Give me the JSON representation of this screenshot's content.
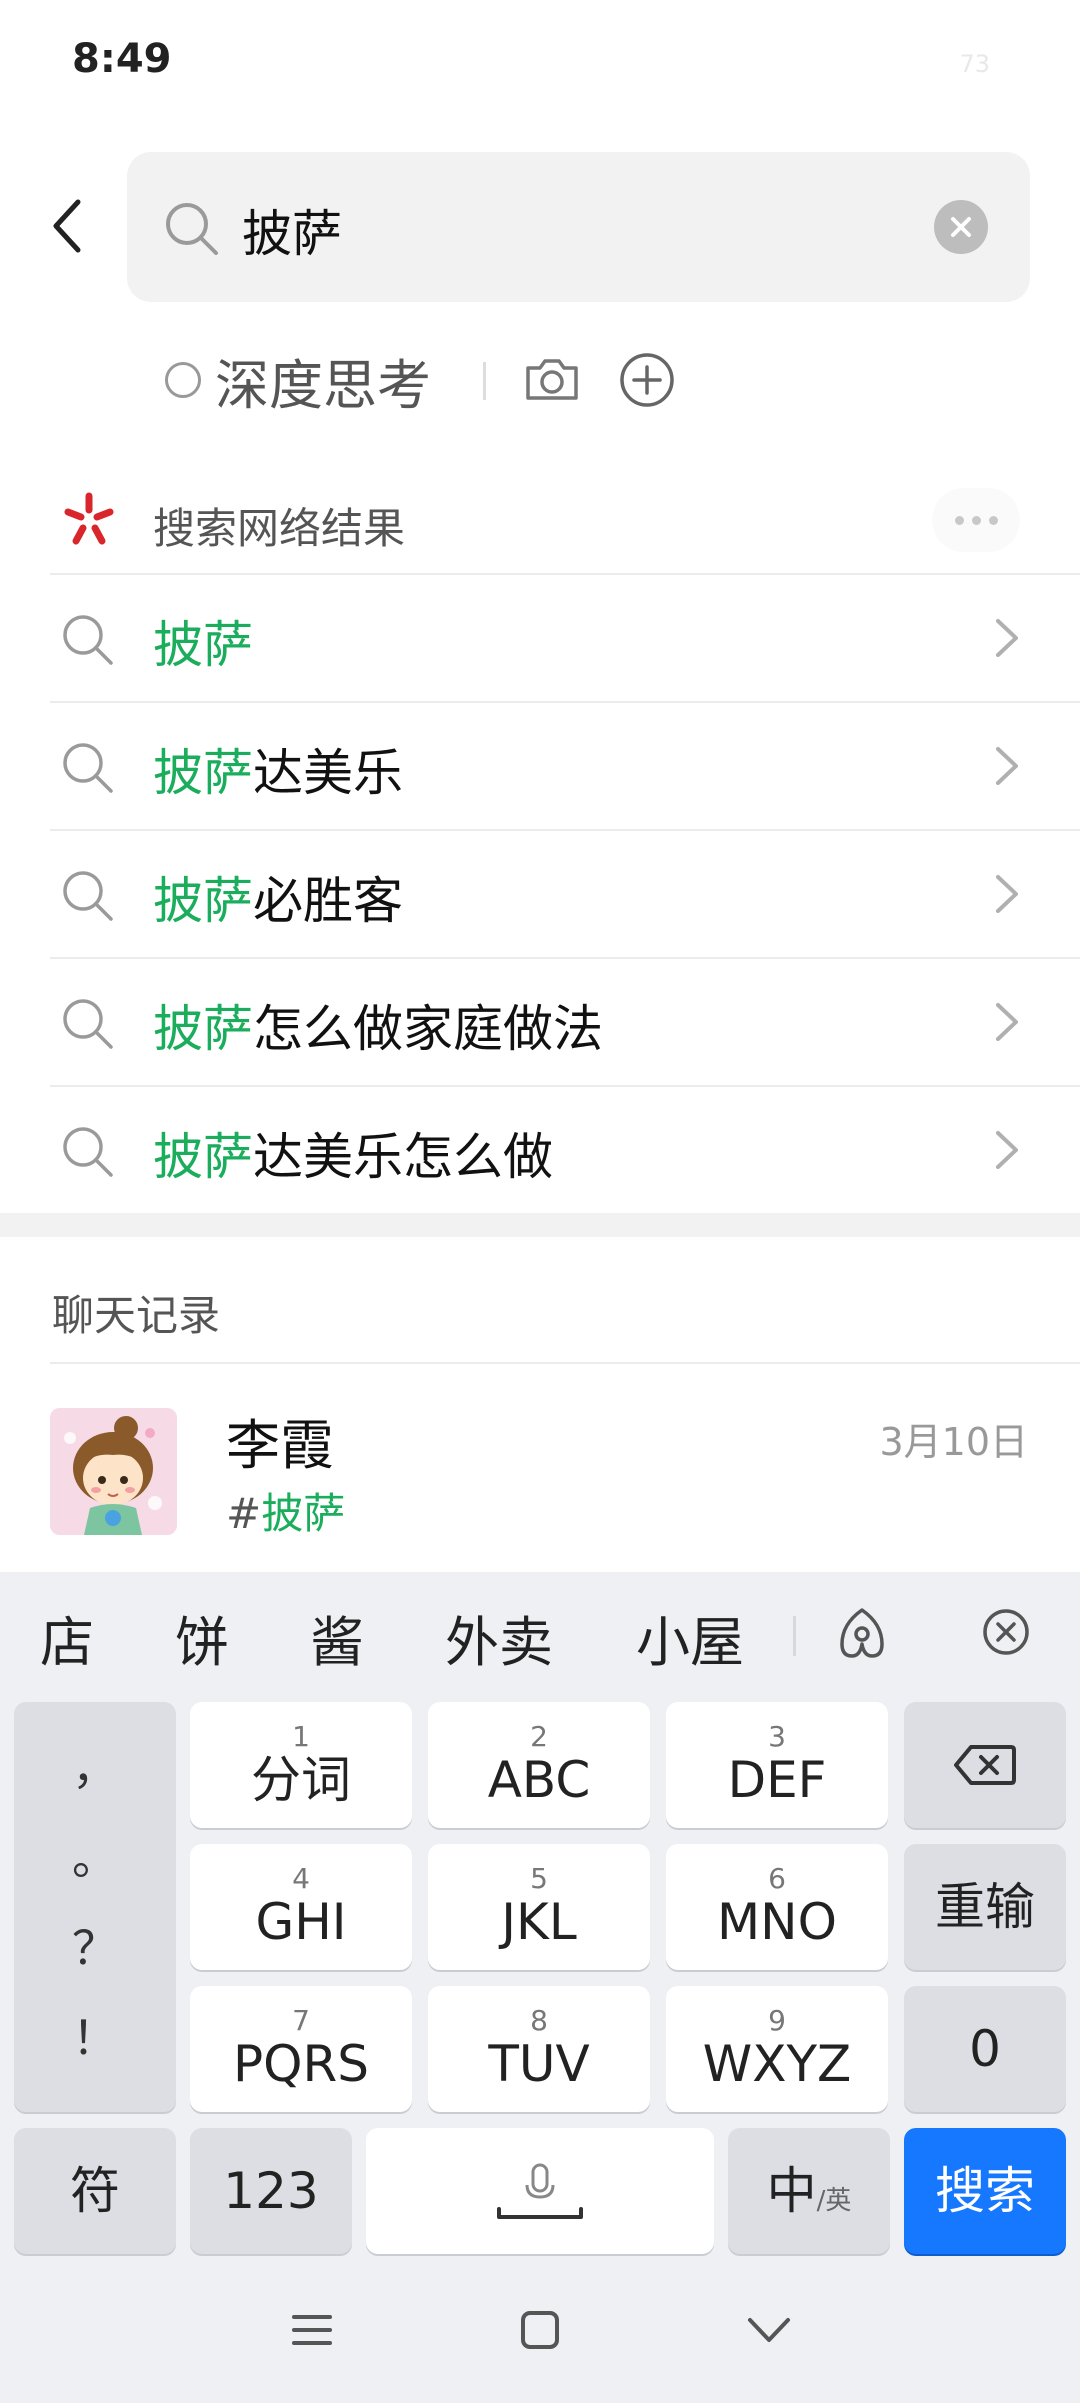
{
  "status_bar": {
    "time": "8:49",
    "battery": "73"
  },
  "search": {
    "query": "披萨"
  },
  "options": {
    "deep_think_label": "深度思考"
  },
  "web_results": {
    "title": "搜索网络结果",
    "suggestions": [
      {
        "highlight": "披萨",
        "rest": ""
      },
      {
        "highlight": "披萨",
        "rest": "达美乐"
      },
      {
        "highlight": "披萨",
        "rest": "必胜客"
      },
      {
        "highlight": "披萨",
        "rest": "怎么做家庭做法"
      },
      {
        "highlight": "披萨",
        "rest": "达美乐怎么做"
      }
    ]
  },
  "chat_records": {
    "title": "聊天记录",
    "items": [
      {
        "name": "李霞",
        "date": "3月10日",
        "snippet_prefix": "#",
        "snippet_highlight": "披萨"
      }
    ]
  },
  "keyboard": {
    "candidates": [
      "店",
      "饼",
      "酱",
      "外卖",
      "小屋"
    ],
    "punctuation": [
      "，",
      "。",
      "？",
      "！"
    ],
    "keys": [
      {
        "num": "1",
        "label": "分词"
      },
      {
        "num": "2",
        "label": "ABC"
      },
      {
        "num": "3",
        "label": "DEF"
      },
      {
        "num": "4",
        "label": "GHI"
      },
      {
        "num": "5",
        "label": "JKL"
      },
      {
        "num": "6",
        "label": "MNO"
      },
      {
        "num": "7",
        "label": "PQRS"
      },
      {
        "num": "8",
        "label": "TUV"
      },
      {
        "num": "9",
        "label": "WXYZ"
      }
    ],
    "reinput_label": "重输",
    "zero_label": "0",
    "symbol_label": "符",
    "num_label": "123",
    "lang_main": "中",
    "lang_sub": "/英",
    "search_label": "搜索"
  },
  "icons": {
    "back": "chevron-left-icon",
    "search": "search-icon",
    "clear": "clear-icon",
    "camera": "camera-icon",
    "plus": "plus-icon",
    "logo": "star-logo-icon",
    "more": "more-icon",
    "chevron": "chevron-right-icon",
    "backspace": "backspace-icon",
    "mic": "mic-icon",
    "handwrite": "handwriting-icon",
    "close_candidates": "close-circle-icon",
    "nav_menu": "menu-icon",
    "nav_home": "home-icon",
    "nav_back": "chevron-down-icon"
  },
  "colors": {
    "highlight": "#1aad5c",
    "primary_key": "#1677ff",
    "logo": "#d9262c"
  }
}
